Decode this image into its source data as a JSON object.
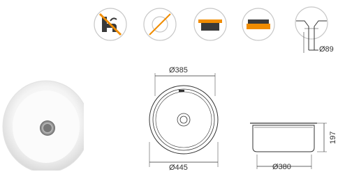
{
  "colors": {
    "accent": "#f08c00",
    "dark_bar": "#3a3a3a",
    "icon_circle": "#c7c7c7",
    "line": "#333333"
  },
  "icons": [
    {
      "name": "no-overflow-icon"
    },
    {
      "name": "no-tap-hole-icon"
    },
    {
      "name": "inset-mount-icon"
    },
    {
      "name": "undermount-icon"
    },
    {
      "name": "drain-pipe-icon"
    }
  ],
  "dimensions": {
    "drain_diameter": "Ø89",
    "top_inner_diameter": "Ø385",
    "outer_diameter": "Ø445",
    "bowl_diameter": "Ø380",
    "depth": "197"
  }
}
